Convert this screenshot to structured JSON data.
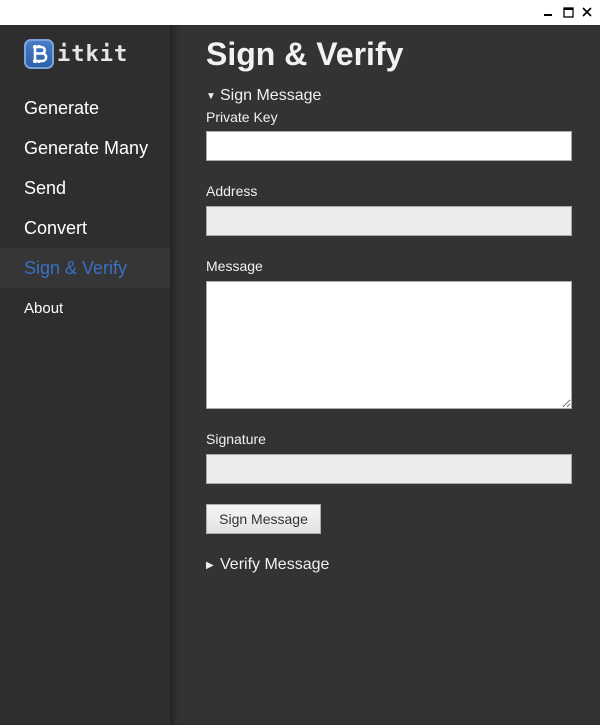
{
  "window": {
    "minimize_glyph": "—",
    "maximize_glyph": "☐",
    "close_glyph": "✕"
  },
  "sidebar": {
    "logo_text": "itkit",
    "logo_icon": "bitcoin-icon",
    "items": [
      {
        "label": "Generate",
        "active": false
      },
      {
        "label": "Generate Many",
        "active": false
      },
      {
        "label": "Send",
        "active": false
      },
      {
        "label": "Convert",
        "active": false
      },
      {
        "label": "Sign & Verify",
        "active": true
      },
      {
        "label": "About",
        "active": false
      }
    ]
  },
  "main": {
    "title": "Sign & Verify",
    "sign_section": {
      "label": "Sign Message",
      "arrow": "▼",
      "expanded": true,
      "private_key_label": "Private Key",
      "private_key_value": "",
      "address_label": "Address",
      "address_value": "",
      "message_label": "Message",
      "message_value": "",
      "signature_label": "Signature",
      "signature_value": "",
      "button_label": "Sign Message"
    },
    "verify_section": {
      "label": "Verify Message",
      "arrow": "▶",
      "expanded": false
    }
  },
  "colors": {
    "sidebar_bg": "#2e2e2e",
    "main_bg": "#333333",
    "active_nav": "#3a6fc2",
    "logo_blue": "#2b5ea8"
  }
}
